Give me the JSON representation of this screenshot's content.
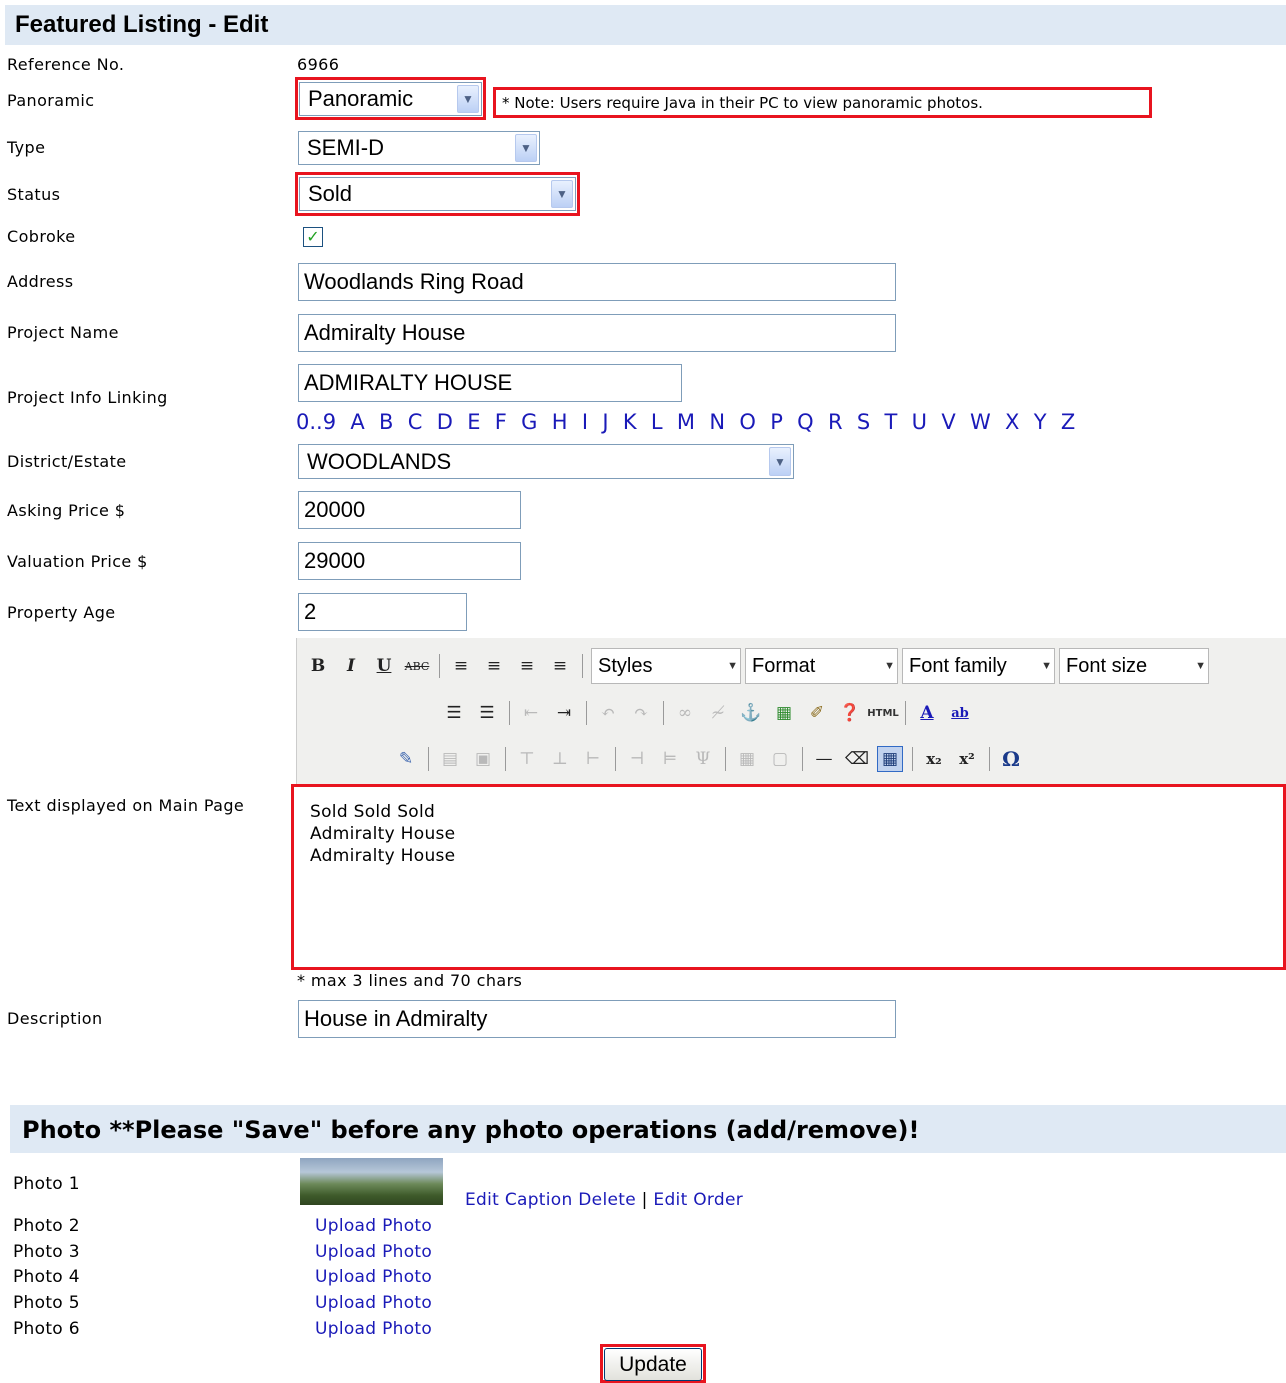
{
  "header": {
    "title": "Featured Listing - Edit"
  },
  "form": {
    "reference": {
      "label": "Reference No.",
      "value": "6966"
    },
    "panoramic": {
      "label": "Panoramic",
      "value": "Panoramic",
      "note": "* Note: Users require Java in their PC to view panoramic photos."
    },
    "type": {
      "label": "Type",
      "value": "SEMI-D"
    },
    "status": {
      "label": "Status",
      "value": "Sold"
    },
    "cobroke": {
      "label": "Cobroke",
      "checked": true
    },
    "address": {
      "label": "Address",
      "value": "Woodlands Ring Road"
    },
    "project_name": {
      "label": "Project Name",
      "value": "Admiralty House"
    },
    "project_info": {
      "label": "Project Info Linking",
      "value": "ADMIRALTY HOUSE"
    },
    "alphabet": [
      "0..9",
      "A",
      "B",
      "C",
      "D",
      "E",
      "F",
      "G",
      "H",
      "I",
      "J",
      "K",
      "L",
      "M",
      "N",
      "O",
      "P",
      "Q",
      "R",
      "S",
      "T",
      "U",
      "V",
      "W",
      "X",
      "Y",
      "Z"
    ],
    "district": {
      "label": "District/Estate",
      "value": "WOODLANDS"
    },
    "asking_price": {
      "label": "Asking Price $",
      "value": "20000"
    },
    "valuation_price": {
      "label": "Valuation Price $",
      "value": "29000"
    },
    "property_age": {
      "label": "Property Age",
      "value": "2"
    },
    "main_text": {
      "label": "Text displayed on Main Page",
      "lines": [
        "Sold Sold Sold",
        "Admiralty House",
        "Admiralty House"
      ],
      "hint": "* max 3 lines and 70 chars"
    },
    "description": {
      "label": "Description",
      "value": "House in Admiralty"
    }
  },
  "editor_toolbar": {
    "styles": "Styles",
    "format": "Format",
    "font_family": "Font family",
    "font_size": "Font size"
  },
  "photo_section": {
    "title": "Photo **Please \"Save\" before any photo operations (add/remove)!",
    "photos": [
      {
        "label": "Photo 1",
        "has_image": true,
        "edit_caption": "Edit Caption",
        "delete": "Delete",
        "edit_order": "Edit Order"
      },
      {
        "label": "Photo 2",
        "upload": "Upload Photo"
      },
      {
        "label": "Photo 3",
        "upload": "Upload Photo"
      },
      {
        "label": "Photo 4",
        "upload": "Upload Photo"
      },
      {
        "label": "Photo 5",
        "upload": "Upload Photo"
      },
      {
        "label": "Photo 6",
        "upload": "Upload Photo"
      }
    ],
    "separator": "|"
  },
  "actions": {
    "update": "Update"
  },
  "colors": {
    "highlight": "#e8141f",
    "header_bg": "#dfe9f4",
    "link": "#1a1ab8"
  }
}
